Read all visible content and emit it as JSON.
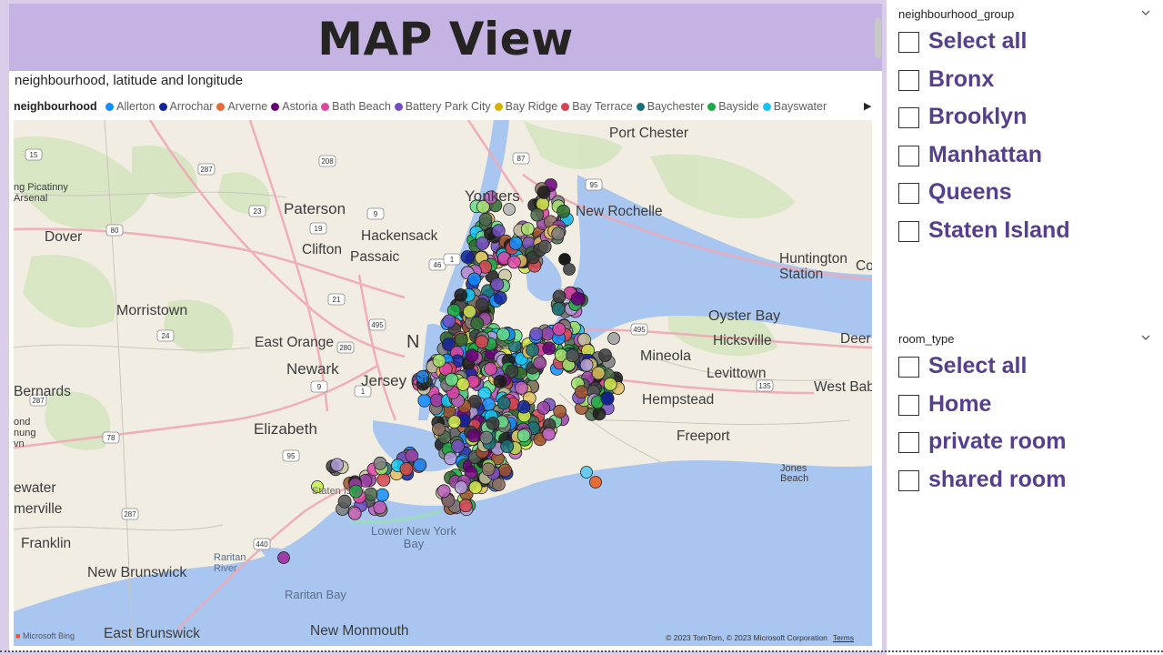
{
  "visual": {
    "title": "MAP View",
    "map_title": "neighbourhood, latitude and longitude",
    "legend_title": "neighbourhood",
    "legend_items": [
      {
        "label": "Allerton",
        "color": "#118dff"
      },
      {
        "label": "Arrochar",
        "color": "#12239e"
      },
      {
        "label": "Arverne",
        "color": "#e66c37"
      },
      {
        "label": "Astoria",
        "color": "#6b007b"
      },
      {
        "label": "Bath Beach",
        "color": "#e044a7"
      },
      {
        "label": "Battery Park City",
        "color": "#744ec2"
      },
      {
        "label": "Bay Ridge",
        "color": "#d9b300"
      },
      {
        "label": "Bay Terrace",
        "color": "#d64550"
      },
      {
        "label": "Baychester",
        "color": "#197278"
      },
      {
        "label": "Bayside",
        "color": "#1aab40"
      },
      {
        "label": "Bayswater",
        "color": "#15c6f4"
      }
    ],
    "legend_more_icon": "triangle-right-icon",
    "map": {
      "place_labels": [
        "Port Chester",
        "Yonkers",
        "New Rochelle",
        "Paterson",
        "Hackensack",
        "Clifton",
        "Passaic",
        "Dover",
        "Morristown",
        "East Orange",
        "Newark",
        "Jersey City",
        "Elizabeth",
        "Huntington Station",
        "Oyster Bay",
        "Hicksville",
        "Mineola",
        "Levittown",
        "Hempstead",
        "West Babylon",
        "Freeport",
        "Jones Beach",
        "Bernards",
        "Franklin",
        "New Brunswick",
        "East Brunswick",
        "New Monmouth",
        "Raritan River",
        "Raritan Bay",
        "Lower New York Bay",
        "Staten Island",
        "Pica Arsen",
        "Deer",
        "Co",
        "N",
        "ewater",
        "merville",
        "ond nung vn",
        "ng Picatinny Arsenal",
        "Cond"
      ],
      "road_shields": [
        "15",
        "287",
        "208",
        "87",
        "95",
        "23",
        "19",
        "80",
        "9",
        "46",
        "1",
        "21",
        "495",
        "295",
        "495",
        "24",
        "280",
        "78",
        "1",
        "9",
        "287",
        "95",
        "135",
        "287",
        "440"
      ],
      "provider": "Microsoft Bing",
      "copyright": "© 2023 TomTom, © 2023 Microsoft Corporation",
      "terms": "Terms"
    }
  },
  "slicers": {
    "neighbourhood_group": {
      "header": "neighbourhood_group",
      "items": [
        "Select all",
        "Bronx",
        "Brooklyn",
        "Manhattan",
        "Queens",
        "Staten Island"
      ]
    },
    "room_type": {
      "header": "room_type",
      "items": [
        "Select all",
        "Home",
        "private room",
        "shared room"
      ]
    }
  },
  "colors": {
    "title_band": "#c5b4e3",
    "canvas": "#d9cdea",
    "slicer_text": "#56408e",
    "water": "#a9c6f0",
    "land": "#f2efe4"
  }
}
